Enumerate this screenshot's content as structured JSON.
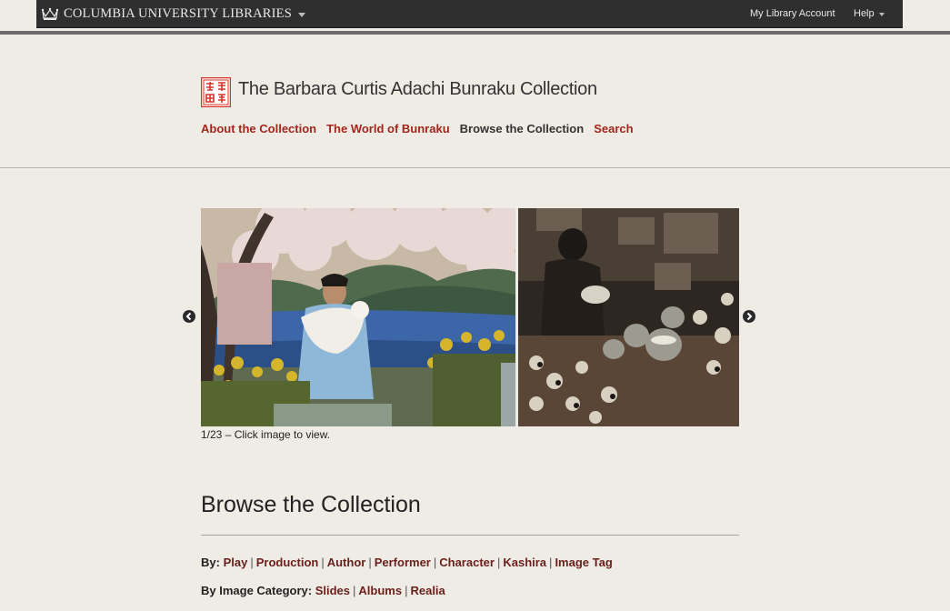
{
  "topbar": {
    "brand": "COLUMBIA UNIVERSITY LIBRARIES",
    "my_account": "My Library Account",
    "help": "Help"
  },
  "header": {
    "title": "The Barbara Curtis Adachi Bunraku Collection",
    "nav": [
      {
        "label": "About the Collection",
        "active": false
      },
      {
        "label": "The World of Bunraku",
        "active": false
      },
      {
        "label": "Browse the Collection",
        "active": true
      },
      {
        "label": "Search",
        "active": false
      }
    ]
  },
  "carousel": {
    "caption": "1/23 – Click image to view.",
    "position": 1,
    "total": 23
  },
  "browse": {
    "title": "Browse the Collection",
    "by_label": "By:",
    "by_links": [
      "Play",
      "Production",
      "Author",
      "Performer",
      "Character",
      "Kashira",
      "Image Tag"
    ],
    "category_label": "By Image Category:",
    "category_links": [
      "Slides",
      "Albums",
      "Realia"
    ]
  },
  "colors": {
    "background": "#efebe5",
    "topbar": "#2f2f2f",
    "nav_link": "#a1261c",
    "browse_link": "#6b1f1a",
    "seal": "#d9322a"
  }
}
